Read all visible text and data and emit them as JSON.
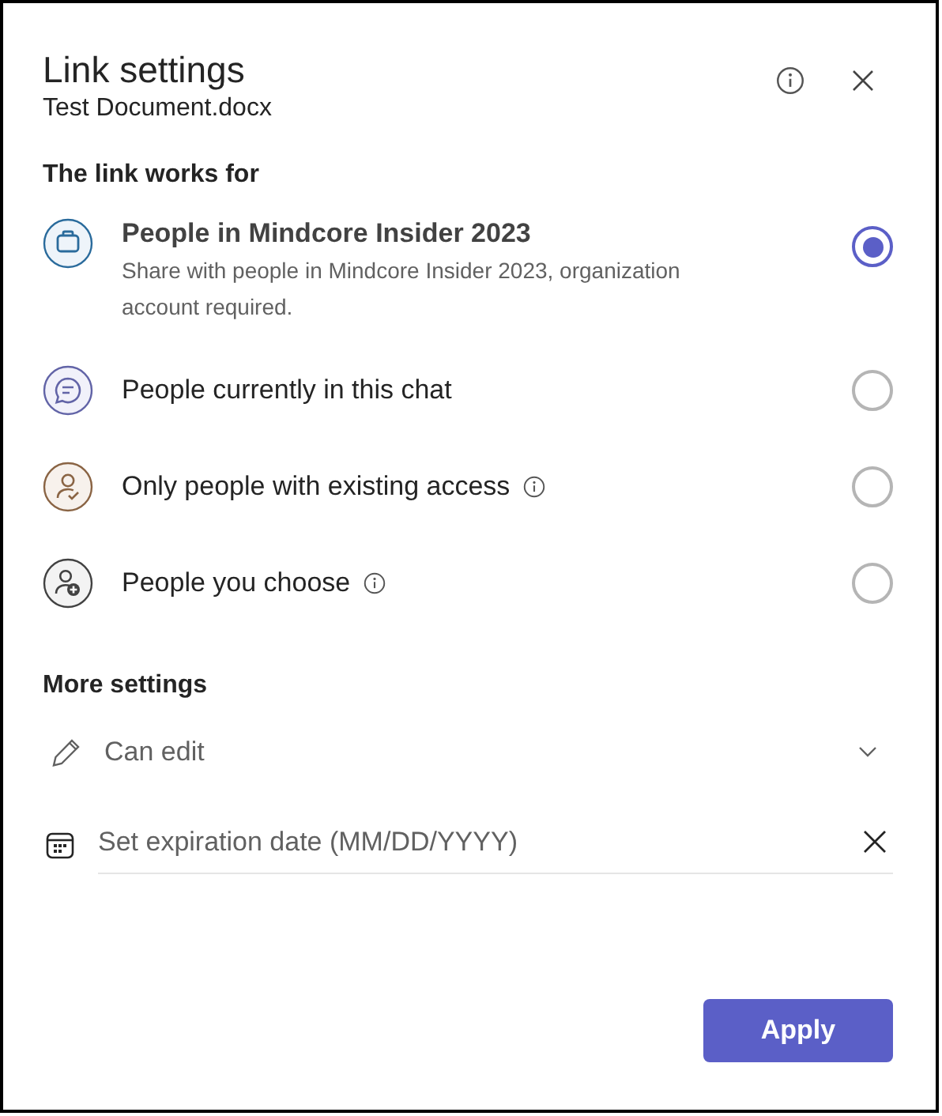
{
  "dialog": {
    "title": "Link settings",
    "subtitle": "Test Document.docx"
  },
  "link_works_for": {
    "heading": "The link works for",
    "options": [
      {
        "kind": "organization",
        "label": "People in Mindcore Insider 2023",
        "description": "Share with people in Mindcore Insider 2023, organization account required.",
        "info": false,
        "selected": true
      },
      {
        "kind": "chat",
        "label": "People currently in this chat",
        "info": false,
        "selected": false
      },
      {
        "kind": "existing",
        "label": "Only people with existing access",
        "info": true,
        "selected": false
      },
      {
        "kind": "choose",
        "label": "People you choose",
        "info": true,
        "selected": false
      }
    ]
  },
  "more_settings": {
    "heading": "More settings",
    "permission": "Can edit",
    "expiration": {
      "placeholder": "Set expiration date (MM/DD/YYYY)"
    }
  },
  "buttons": {
    "apply": "Apply"
  }
}
